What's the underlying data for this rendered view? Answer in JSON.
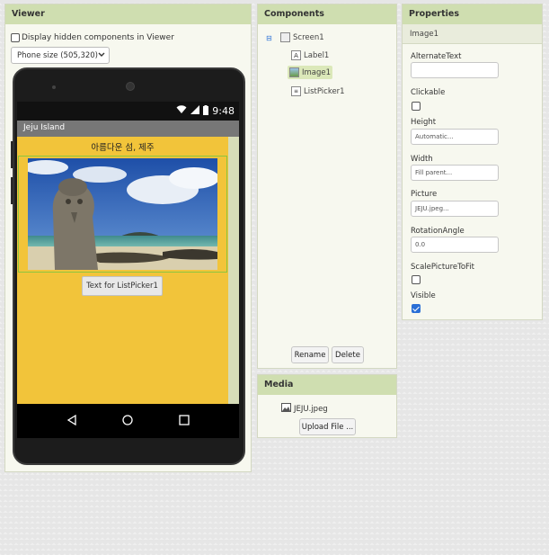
{
  "viewer": {
    "title": "Viewer",
    "show_hidden_label": "Display hidden components in Viewer",
    "size_select": "Phone size (505,320)",
    "phone": {
      "status_time": "9:48",
      "app_title": "Jeju Island",
      "label_text": "아름다운 섬, 제주",
      "listpicker_text": "Text for ListPicker1"
    }
  },
  "components": {
    "title": "Components",
    "tree": [
      {
        "name": "Screen1",
        "icon": "screen-icon"
      },
      {
        "name": "Label1",
        "icon": "label-icon"
      },
      {
        "name": "Image1",
        "icon": "image-icon",
        "selected": true
      },
      {
        "name": "ListPicker1",
        "icon": "listpicker-icon"
      }
    ],
    "rename_label": "Rename",
    "delete_label": "Delete"
  },
  "media": {
    "title": "Media",
    "file": "JEJU.jpeg",
    "upload_label": "Upload File ..."
  },
  "properties": {
    "title": "Properties",
    "component": "Image1",
    "alternate_text": {
      "label": "AlternateText",
      "value": ""
    },
    "clickable": {
      "label": "Clickable",
      "checked": false
    },
    "height": {
      "label": "Height",
      "value": "Automatic..."
    },
    "width": {
      "label": "Width",
      "value": "Fill parent..."
    },
    "picture": {
      "label": "Picture",
      "value": "JEJU.jpeg..."
    },
    "rotation_angle": {
      "label": "RotationAngle",
      "value": "0.0"
    },
    "scale_picture": {
      "label": "ScalePictureToFit",
      "checked": false
    },
    "visible": {
      "label": "Visible",
      "checked": true
    }
  },
  "colors": {
    "panel_header": "#cfdeb0",
    "app_background": "#f2c43a",
    "selection": "#dbe8b9",
    "checkbox_checked": "#2a6fd6"
  }
}
